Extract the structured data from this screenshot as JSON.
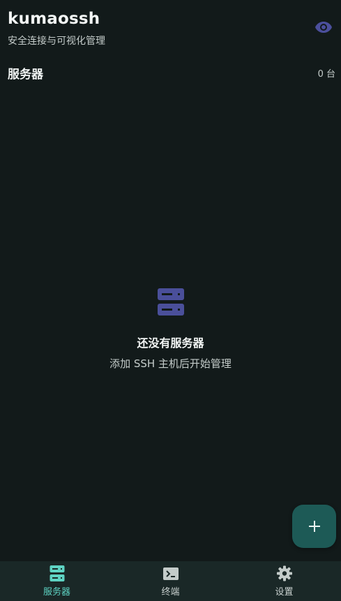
{
  "header": {
    "title": "kumaossh",
    "subtitle": "安全连接与可视化管理",
    "visibility_icon": "eye-icon"
  },
  "section": {
    "title": "服务器",
    "count": "0 台"
  },
  "empty_state": {
    "icon": "server-icon",
    "title": "还没有服务器",
    "description": "添加 SSH 主机后开始管理"
  },
  "fab": {
    "icon": "plus-icon"
  },
  "bottom_nav": {
    "items": [
      {
        "label": "服务器",
        "icon": "server-icon",
        "active": true
      },
      {
        "label": "终端",
        "icon": "terminal-icon",
        "active": false
      },
      {
        "label": "设置",
        "icon": "gear-icon",
        "active": false
      }
    ]
  },
  "colors": {
    "background": "#121a1a",
    "accent": "#5ed3c3",
    "empty_icon": "#4a4f9a",
    "fab_background": "#1d5a56",
    "nav_background": "#1a2827"
  }
}
